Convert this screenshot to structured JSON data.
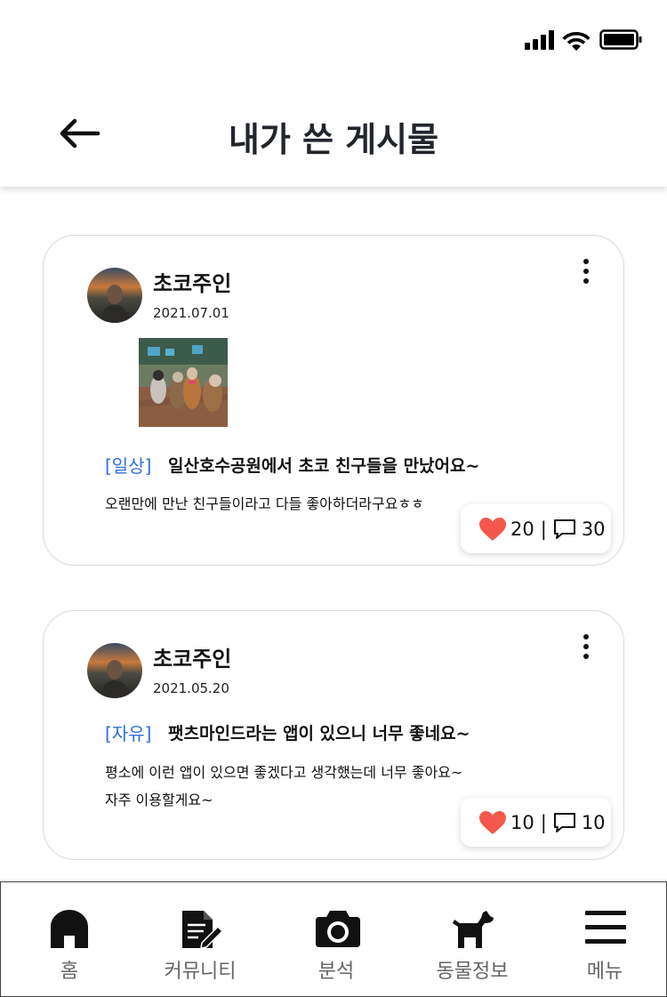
{
  "header": {
    "title": "내가 쓴 게시물",
    "back_icon": "arrow-left-icon"
  },
  "posts": [
    {
      "author": "초코주인",
      "date": "2021.07.01",
      "category": "[일상]",
      "title": "일산호수공원에서 초코 친구들을 만났어요~",
      "body": "오랜만에 만난 친구들이라고 다들 좋아하더라구요ㅎㅎ",
      "likes": "20",
      "separator": "|",
      "comments": "30",
      "has_image": true
    },
    {
      "author": "초코주인",
      "date": "2021.05.20",
      "category": "[자유]",
      "title": "팻츠마인드라는 앱이 있으니 너무 좋네요~",
      "body_lines": [
        "평소에 이런 앱이 있으면 좋겠다고 생각했는데 너무 좋아요~",
        "자주 이용할게요~"
      ],
      "likes": "10",
      "separator": "|",
      "comments": "10",
      "has_image": false
    }
  ],
  "nav": [
    {
      "label": "홈",
      "icon": "home-icon"
    },
    {
      "label": "커뮤니티",
      "icon": "document-edit-icon"
    },
    {
      "label": "분석",
      "icon": "camera-icon"
    },
    {
      "label": "동물정보",
      "icon": "dog-icon"
    },
    {
      "label": "메뉴",
      "icon": "hamburger-menu-icon"
    }
  ],
  "colors": {
    "category": "#2f6fd8",
    "heart": "#f4584c",
    "title": "#22252b",
    "nav_label": "#666666"
  }
}
